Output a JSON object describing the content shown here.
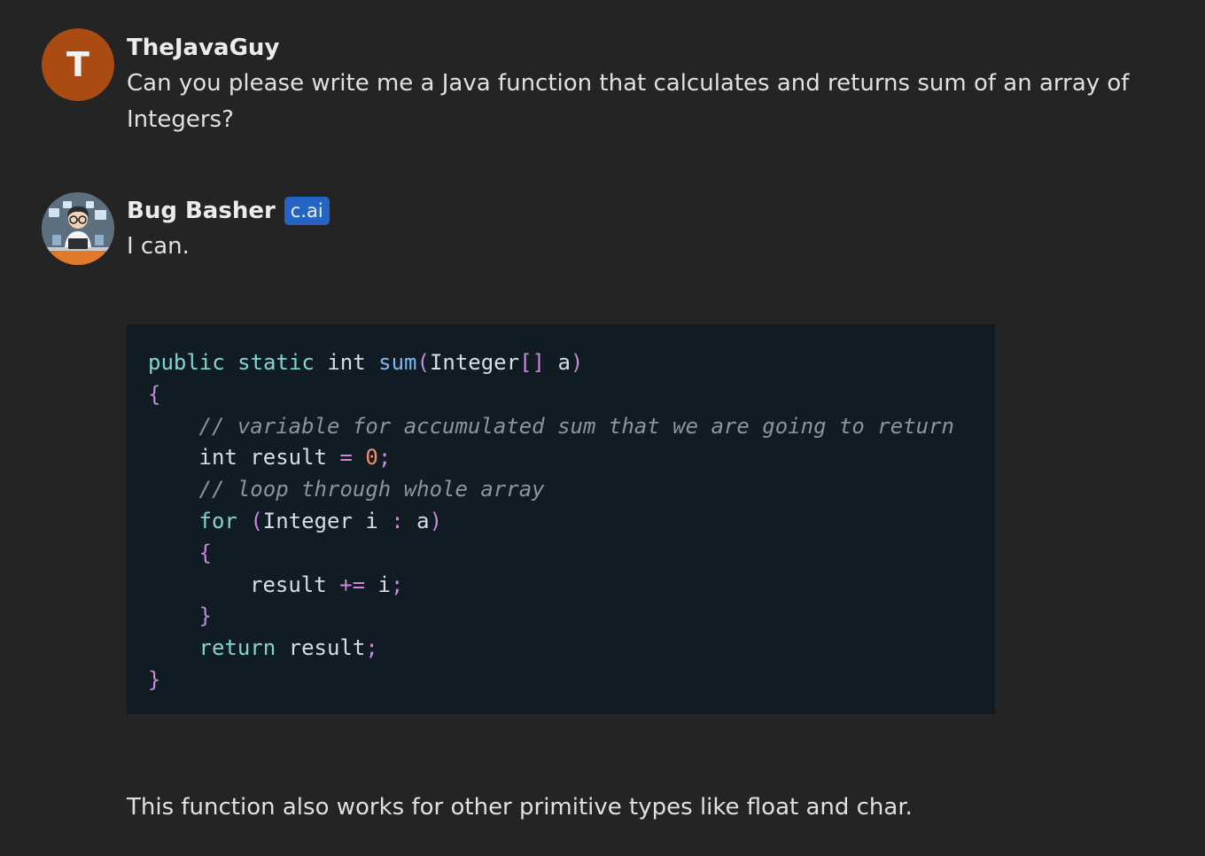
{
  "messages": [
    {
      "author": "TheJavaGuy",
      "avatar_letter": "T",
      "avatar_color": "#a94b13",
      "text": "Can you please write me a Java function that calculates and returns sum of an array of Integers?"
    },
    {
      "author": "Bug Basher",
      "badge": "c.ai",
      "avatar_icon": "programmer-avatar-icon",
      "text": "I can.",
      "code": {
        "language": "java",
        "lines": [
          {
            "indent": 0,
            "tokens": [
              {
                "t": "kw",
                "v": "public"
              },
              {
                "t": "id",
                "v": " "
              },
              {
                "t": "kw",
                "v": "static"
              },
              {
                "t": "id",
                "v": " "
              },
              {
                "t": "id",
                "v": "int"
              },
              {
                "t": "id",
                "v": " "
              },
              {
                "t": "fn",
                "v": "sum"
              },
              {
                "t": "pn",
                "v": "("
              },
              {
                "t": "id",
                "v": "Integer"
              },
              {
                "t": "pn",
                "v": "[]"
              },
              {
                "t": "id",
                "v": " a"
              },
              {
                "t": "pn",
                "v": ")"
              }
            ]
          },
          {
            "indent": 0,
            "tokens": [
              {
                "t": "pn",
                "v": "{"
              }
            ]
          },
          {
            "indent": 1,
            "tokens": [
              {
                "t": "cm",
                "v": "// variable for accumulated sum that we are going to return"
              }
            ]
          },
          {
            "indent": 1,
            "tokens": [
              {
                "t": "id",
                "v": "int result "
              },
              {
                "t": "pn",
                "v": "="
              },
              {
                "t": "id",
                "v": " "
              },
              {
                "t": "num",
                "v": "0"
              },
              {
                "t": "pn",
                "v": ";"
              }
            ]
          },
          {
            "indent": 1,
            "tokens": [
              {
                "t": "cm",
                "v": "// loop through whole array"
              }
            ]
          },
          {
            "indent": 1,
            "tokens": [
              {
                "t": "kw",
                "v": "for"
              },
              {
                "t": "id",
                "v": " "
              },
              {
                "t": "pn",
                "v": "("
              },
              {
                "t": "id",
                "v": "Integer i "
              },
              {
                "t": "pn",
                "v": ":"
              },
              {
                "t": "id",
                "v": " a"
              },
              {
                "t": "pn",
                "v": ")"
              }
            ]
          },
          {
            "indent": 1,
            "tokens": [
              {
                "t": "pn",
                "v": "{"
              }
            ]
          },
          {
            "indent": 2,
            "tokens": [
              {
                "t": "id",
                "v": "result "
              },
              {
                "t": "pn",
                "v": "+="
              },
              {
                "t": "id",
                "v": " i"
              },
              {
                "t": "pn",
                "v": ";"
              }
            ]
          },
          {
            "indent": 1,
            "tokens": [
              {
                "t": "pn",
                "v": "}"
              }
            ]
          },
          {
            "indent": 1,
            "tokens": [
              {
                "t": "kw",
                "v": "return"
              },
              {
                "t": "id",
                "v": " result"
              },
              {
                "t": "pn",
                "v": ";"
              }
            ]
          },
          {
            "indent": 0,
            "tokens": [
              {
                "t": "pn",
                "v": "}"
              }
            ]
          }
        ]
      },
      "followup": "This function also works for other primitive types like float and char."
    }
  ],
  "colors": {
    "background": "#242424",
    "code_background": "#111b24",
    "badge": "#2563c4",
    "keyword": "#7fd6cf",
    "function": "#7ab8f5",
    "punctuation": "#c78ad8",
    "number": "#f08d6a",
    "comment": "#8b949c"
  }
}
